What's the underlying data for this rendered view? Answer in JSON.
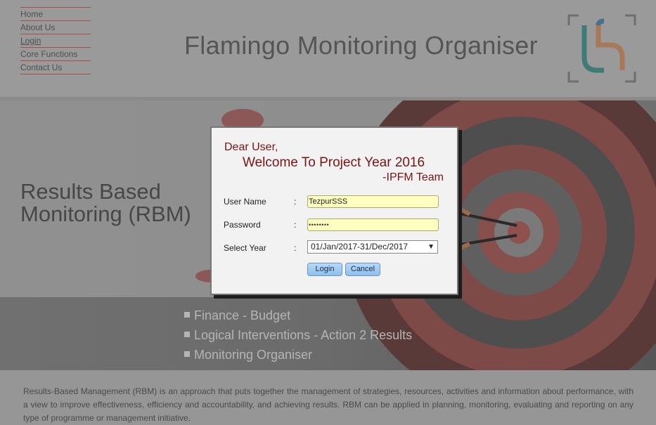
{
  "nav": {
    "items": [
      "Home",
      "About Us",
      "Login",
      "Core Functions",
      "Contact Us"
    ]
  },
  "header": {
    "title": "Flamingo Monitoring Organiser",
    "logo_icon": "fmo-logo-icon"
  },
  "hero": {
    "heading_line1": "Results Based",
    "heading_line2": "Monitoring (RBM)",
    "features": [
      "Finance - Budget",
      "Logical Interventions - Action 2 Results",
      "Monitoring Organiser"
    ]
  },
  "description": "Results-Based Management (RBM) is an approach that puts together the management of strategies, resources, activities and information about performance, with a view to improve effectiveness, efficiency and accountability, and achieving results. RBM can be applied in planning, monitoring, evaluating and reporting on any type of programme or management initiative.",
  "login": {
    "greeting": "Dear User,",
    "welcome": "Welcome To Project Year 2016",
    "signature": "-IPFM Team",
    "username_label": "User Name",
    "username_value": "TezpurSSS",
    "password_label": "Password",
    "password_masked": "••••••••",
    "year_label": "Select Year",
    "year_value": "01/Jan/2017-31/Dec/2017",
    "colon": ":",
    "login_button": "Login",
    "cancel_button": "Cancel"
  },
  "colors": {
    "nav_rule": "#b04a4a",
    "greeting_text": "#7a1414",
    "input_fill": "#ffffc0",
    "button_fill": "#9fcbf2"
  }
}
